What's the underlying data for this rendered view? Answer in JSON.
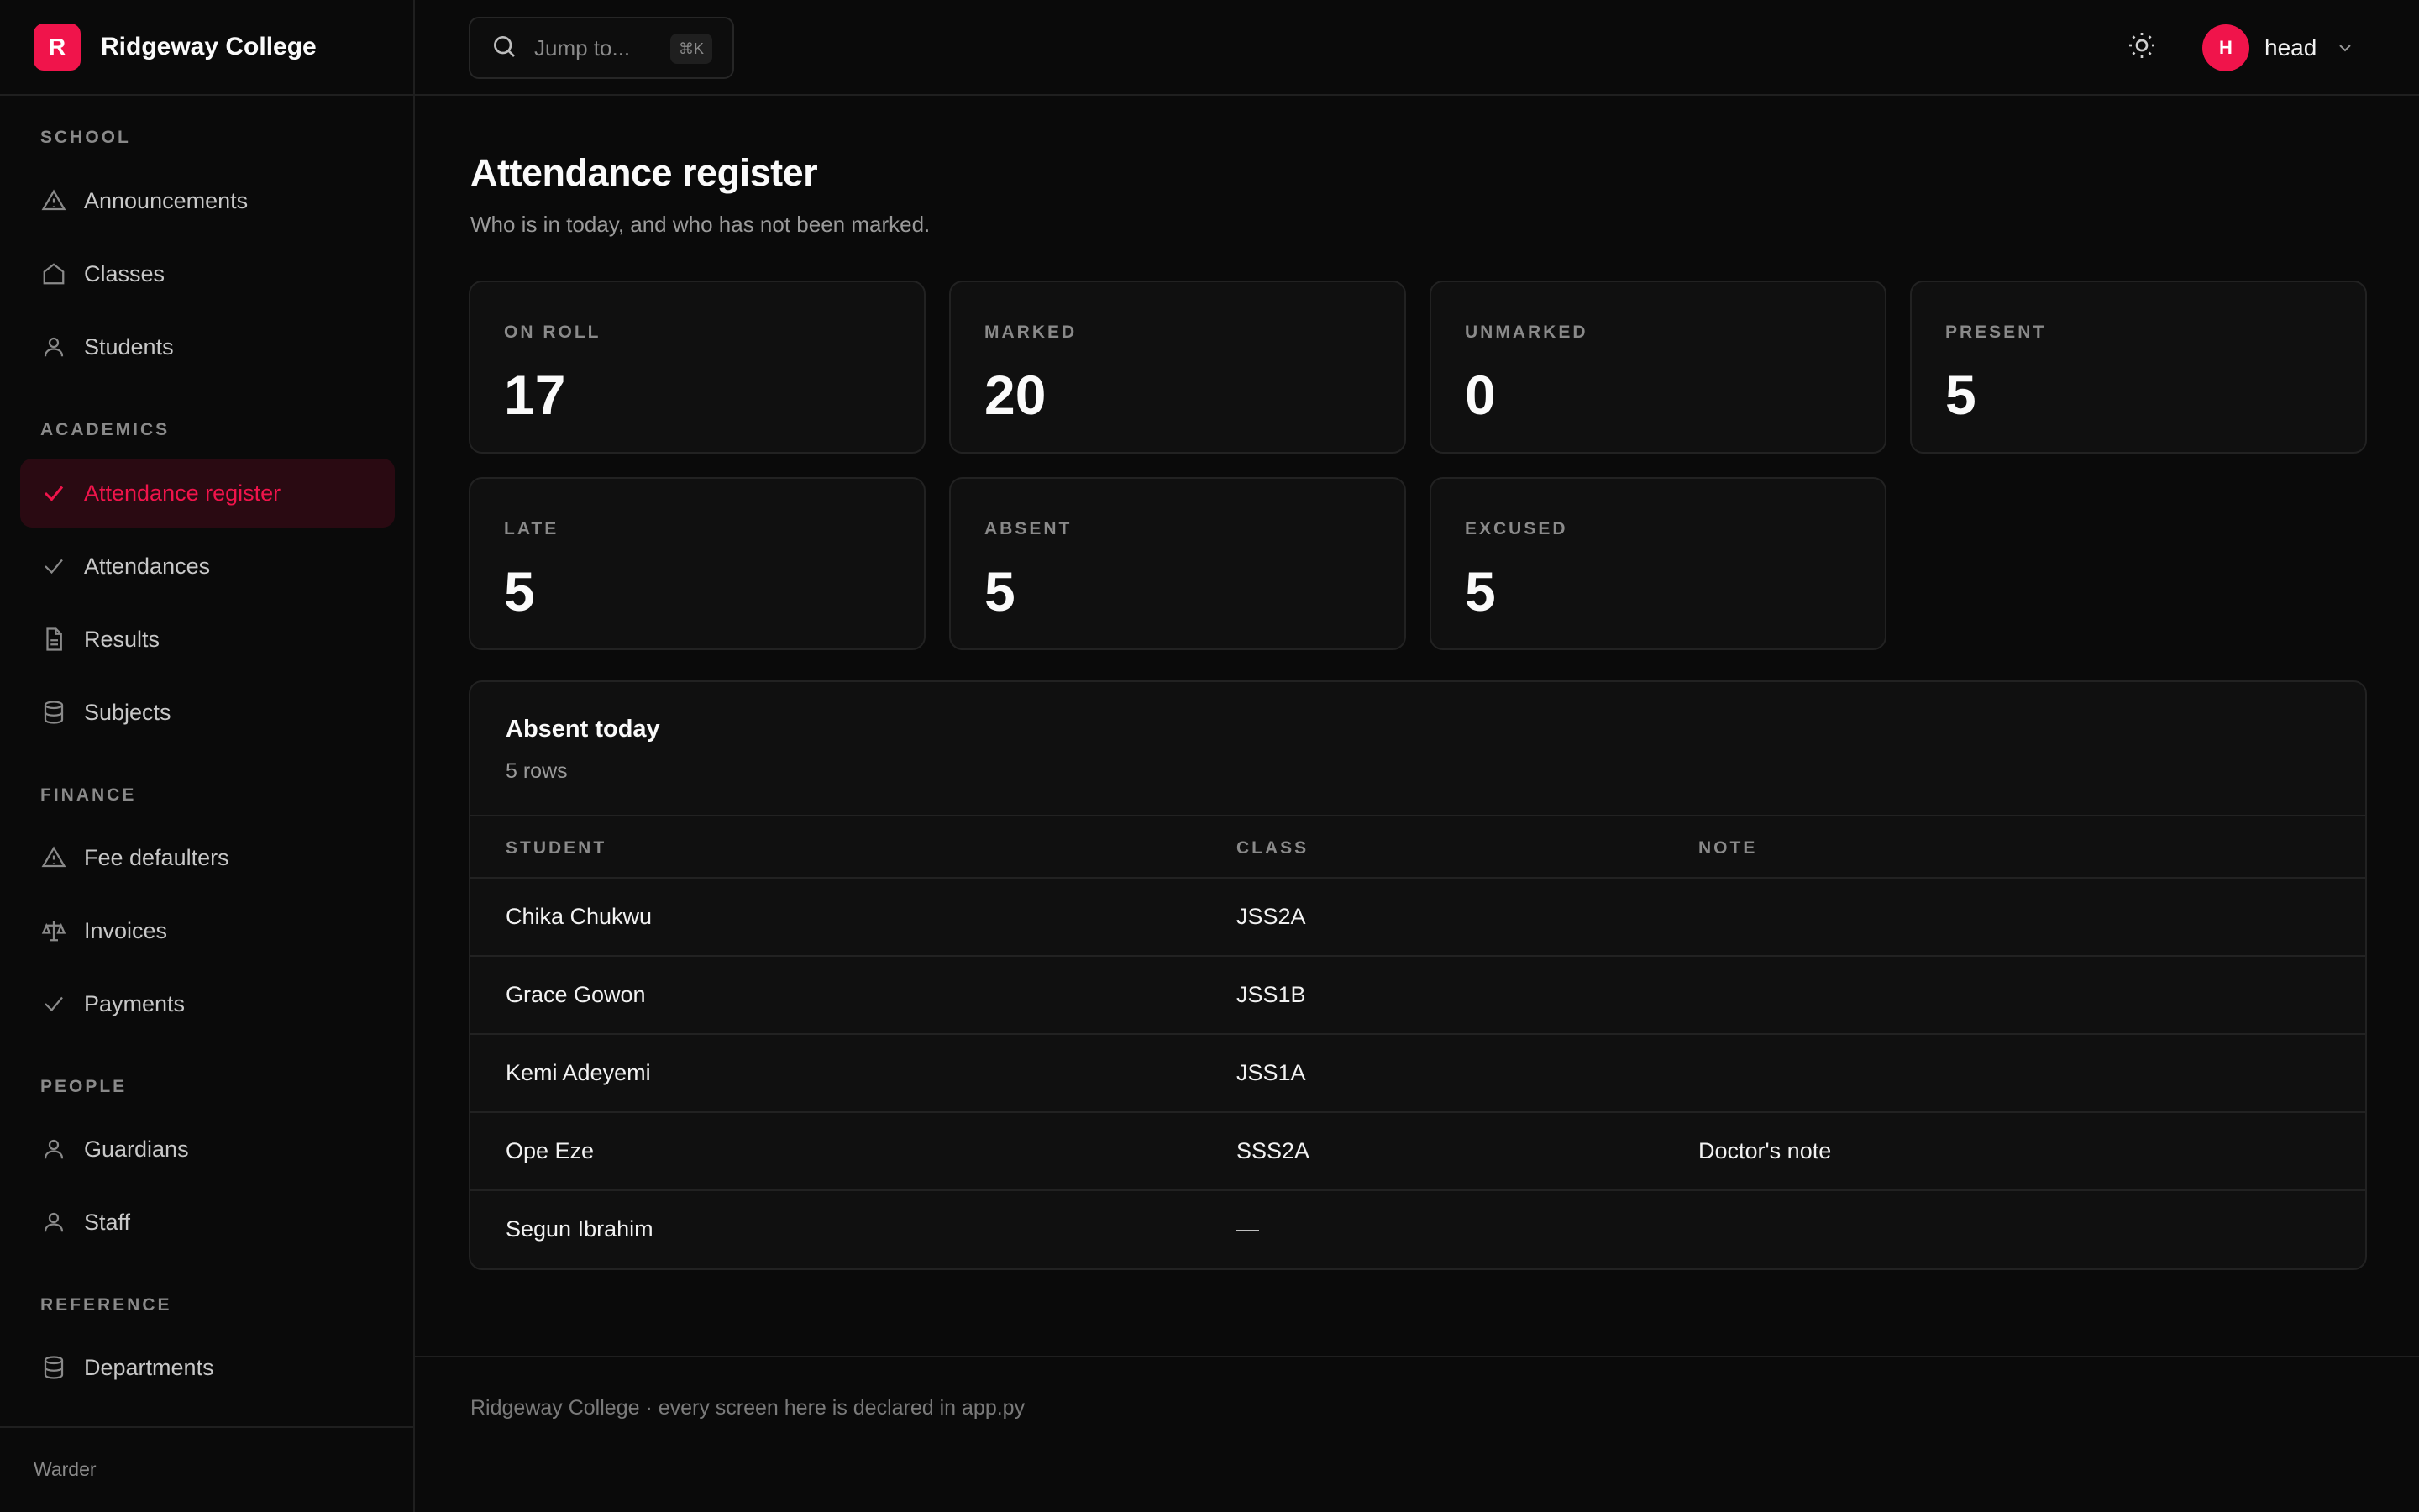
{
  "brand": {
    "logo_letter": "R",
    "name": "Ridgeway College",
    "accent": "#f0144b"
  },
  "sidebar": {
    "sections": [
      {
        "title": "SCHOOL",
        "items": [
          {
            "label": "Announcements",
            "icon": "alert-triangle-icon"
          },
          {
            "label": "Classes",
            "icon": "home-icon"
          },
          {
            "label": "Students",
            "icon": "user-icon"
          }
        ]
      },
      {
        "title": "ACADEMICS",
        "items": [
          {
            "label": "Attendance register",
            "icon": "check-icon",
            "active": true
          },
          {
            "label": "Attendances",
            "icon": "check-icon"
          },
          {
            "label": "Results",
            "icon": "file-text-icon"
          },
          {
            "label": "Subjects",
            "icon": "database-icon"
          }
        ]
      },
      {
        "title": "FINANCE",
        "items": [
          {
            "label": "Fee defaulters",
            "icon": "alert-triangle-icon"
          },
          {
            "label": "Invoices",
            "icon": "scale-icon"
          },
          {
            "label": "Payments",
            "icon": "check-icon"
          }
        ]
      },
      {
        "title": "PEOPLE",
        "items": [
          {
            "label": "Guardians",
            "icon": "user-icon"
          },
          {
            "label": "Staff",
            "icon": "user-icon"
          }
        ]
      },
      {
        "title": "REFERENCE",
        "items": [
          {
            "label": "Departments",
            "icon": "database-icon"
          }
        ]
      }
    ],
    "footer": "Warder"
  },
  "topbar": {
    "search_placeholder": "Jump to...",
    "search_shortcut": "⌘K",
    "user_initial": "H",
    "user_name": "head"
  },
  "page": {
    "title": "Attendance register",
    "subtitle": "Who is in today, and who has not been marked."
  },
  "stats": [
    {
      "label": "ON ROLL",
      "value": "17"
    },
    {
      "label": "MARKED",
      "value": "20"
    },
    {
      "label": "UNMARKED",
      "value": "0"
    },
    {
      "label": "PRESENT",
      "value": "5"
    },
    {
      "label": "LATE",
      "value": "5"
    },
    {
      "label": "ABSENT",
      "value": "5"
    },
    {
      "label": "EXCUSED",
      "value": "5"
    }
  ],
  "absent_table": {
    "title": "Absent today",
    "count_text": "5 rows",
    "columns": [
      "STUDENT",
      "CLASS",
      "NOTE"
    ],
    "rows": [
      [
        "Chika Chukwu",
        "JSS2A",
        ""
      ],
      [
        "Grace Gowon",
        "JSS1B",
        ""
      ],
      [
        "Kemi Adeyemi",
        "JSS1A",
        ""
      ],
      [
        "Ope Eze",
        "SSS2A",
        "Doctor's note"
      ],
      [
        "Segun Ibrahim",
        "—",
        ""
      ]
    ]
  },
  "footer": {
    "text": "Ridgeway College · every screen here is declared in app.py"
  }
}
